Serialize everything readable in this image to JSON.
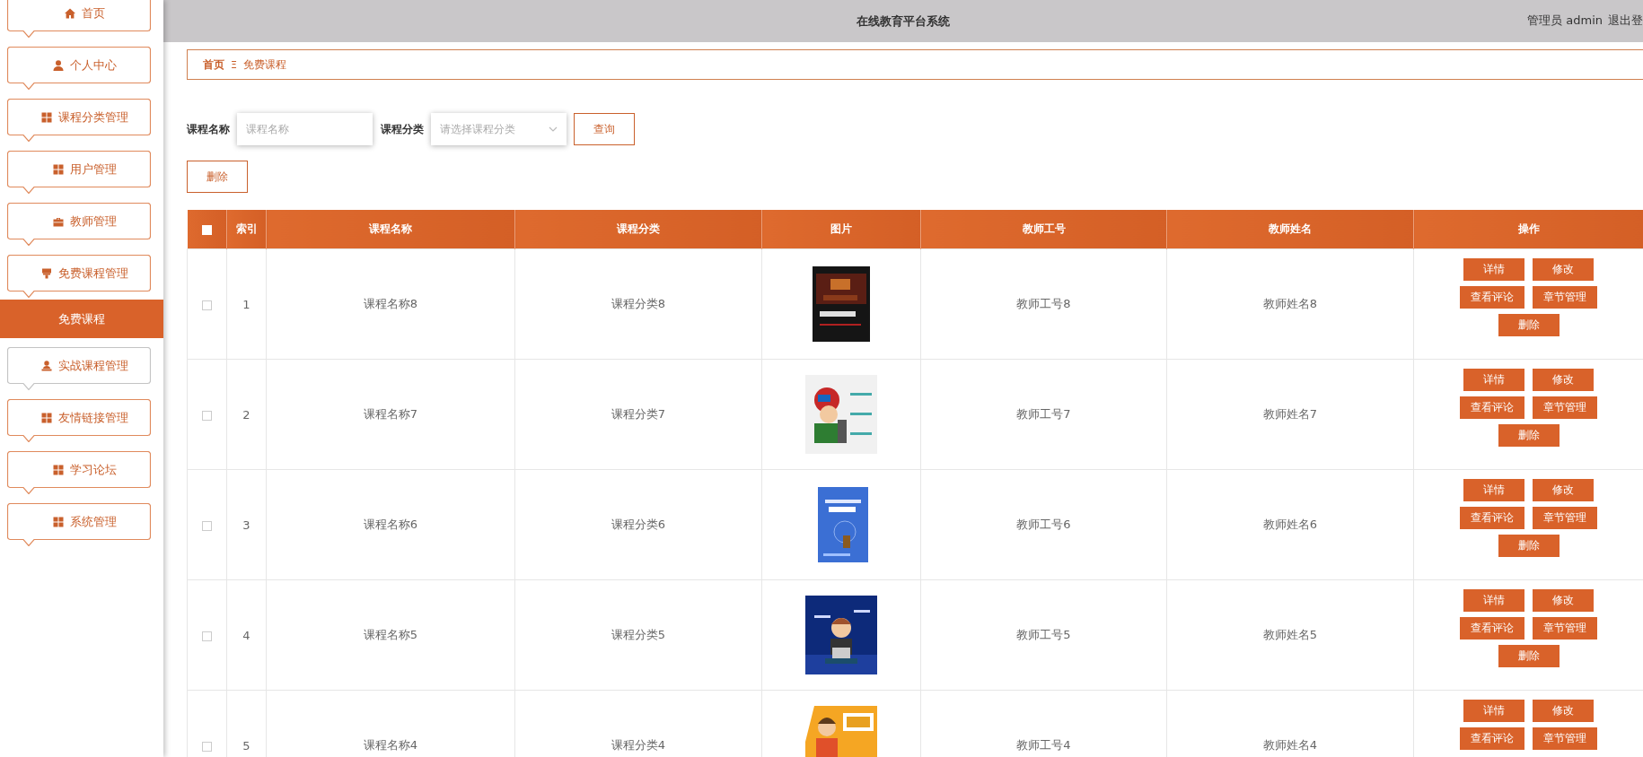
{
  "sidebar": {
    "items": [
      {
        "label": "首页",
        "kind": "home",
        "hovered": false
      },
      {
        "label": "个人中心",
        "kind": "person",
        "hovered": false
      },
      {
        "label": "课程分类管理",
        "kind": "grid",
        "hovered": false
      },
      {
        "label": "用户管理",
        "kind": "grid",
        "hovered": false
      },
      {
        "label": "教师管理",
        "kind": "briefcase",
        "hovered": false
      },
      {
        "label": "免费课程管理",
        "kind": "stamp",
        "hovered": false,
        "children": [
          {
            "label": "免费课程",
            "selected": true
          }
        ]
      },
      {
        "label": "实战课程管理",
        "kind": "bust",
        "hovered": true
      },
      {
        "label": "友情链接管理",
        "kind": "grid",
        "hovered": false
      },
      {
        "label": "学习论坛",
        "kind": "grid",
        "hovered": false
      },
      {
        "label": "系统管理",
        "kind": "grid",
        "hovered": false
      }
    ]
  },
  "header": {
    "title": "在线教育平台系统",
    "user": "管理员 admin",
    "logout": "退出登"
  },
  "breadcrumb": {
    "home": "首页",
    "separator": "Ξ",
    "current": "免费课程"
  },
  "search": {
    "fields": [
      {
        "label": "课程名称",
        "kind": "input",
        "placeholder": "课程名称"
      },
      {
        "label": "课程分类",
        "kind": "select",
        "placeholder": "请选择课程分类"
      }
    ],
    "button": "查询"
  },
  "delete_button": "删除",
  "table": {
    "header_checkbox": {
      "checked": false
    },
    "columns": [
      "索引",
      "课程名称",
      "课程分类",
      "图片",
      "教师工号",
      "教师姓名",
      "操作"
    ],
    "rows": [
      {
        "checked": false,
        "index": "1",
        "name": "课程名称8",
        "category": "课程分类8",
        "image": {
          "kind": "picture"
        },
        "teacher_id": "教师工号8",
        "teacher_name": "教师姓名8",
        "actions": [
          "详情",
          "修改",
          "查看评论",
          "章节管理",
          "删除"
        ]
      },
      {
        "checked": false,
        "index": "2",
        "name": "课程名称7",
        "category": "课程分类7",
        "image": {
          "kind": "picture"
        },
        "teacher_id": "教师工号7",
        "teacher_name": "教师姓名7",
        "actions": [
          "详情",
          "修改",
          "查看评论",
          "章节管理",
          "删除"
        ]
      },
      {
        "checked": false,
        "index": "3",
        "name": "课程名称6",
        "category": "课程分类6",
        "image": {
          "kind": "picture"
        },
        "teacher_id": "教师工号6",
        "teacher_name": "教师姓名6",
        "actions": [
          "详情",
          "修改",
          "查看评论",
          "章节管理",
          "删除"
        ]
      },
      {
        "checked": false,
        "index": "4",
        "name": "课程名称5",
        "category": "课程分类5",
        "image": {
          "kind": "picture"
        },
        "teacher_id": "教师工号5",
        "teacher_name": "教师姓名5",
        "actions": [
          "详情",
          "修改",
          "查看评论",
          "章节管理",
          "删除"
        ]
      },
      {
        "checked": false,
        "index": "5",
        "name": "课程名称4",
        "category": "课程分类4",
        "image": {
          "kind": "picture"
        },
        "teacher_id": "教师工号4",
        "teacher_name": "教师姓名4",
        "actions": [
          "详情",
          "修改",
          "查看评论",
          "章节管理"
        ]
      }
    ]
  }
}
